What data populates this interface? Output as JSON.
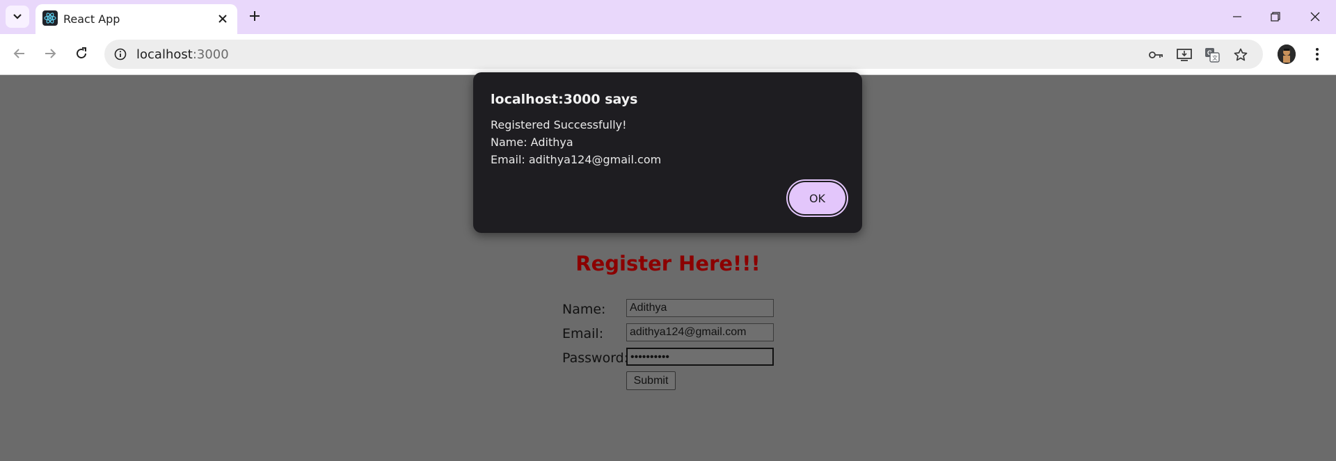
{
  "browser": {
    "tab_title": "React App",
    "tab_favicon": "react-icon",
    "url_host": "localhost",
    "url_port": ":3000",
    "accent": "#e9d8fb"
  },
  "page": {
    "heading": "Register Here!!!",
    "heading_color": "#8b0000",
    "fields": {
      "name_label": "Name:",
      "name_value": "Adithya",
      "email_label": "Email:",
      "email_value": "adithya124@gmail.com",
      "password_label": "Password:",
      "password_value": "••••••••••"
    },
    "submit_label": "Submit"
  },
  "dialog": {
    "title": "localhost:3000 says",
    "message_line1": "Registered Successfully!",
    "message_line2": "Name: Adithya",
    "message_line3": "Email: adithya124@gmail.com",
    "ok_label": "OK"
  }
}
